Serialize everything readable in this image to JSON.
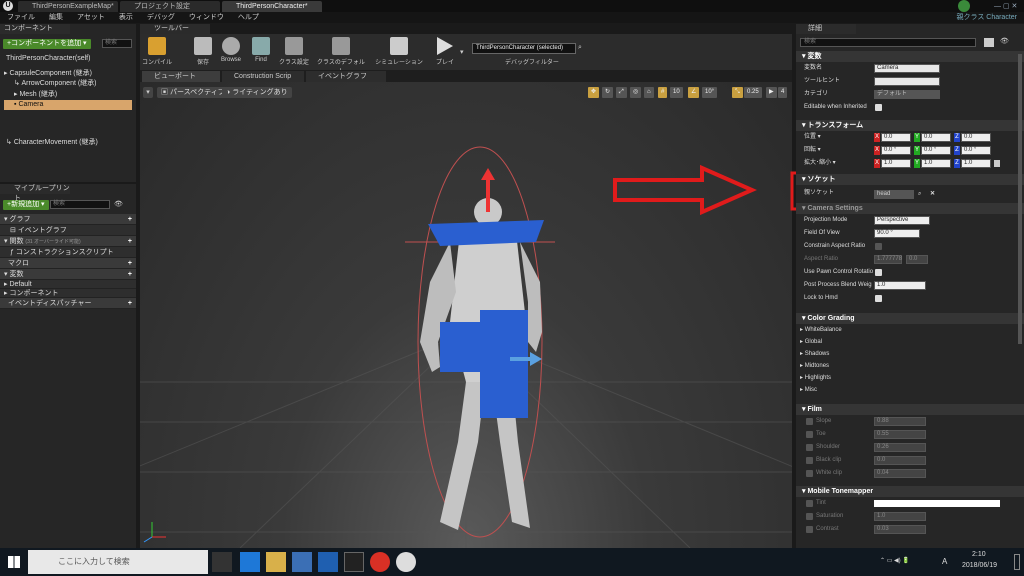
{
  "window": {
    "tabs": [
      "ThirdPersonExampleMap*",
      "プロジェクト設定",
      "ThirdPersonCharacter*"
    ],
    "parent_class_label": "親クラス Character"
  },
  "menu": [
    "ファイル",
    "編集",
    "アセット",
    "表示",
    "デバッグ",
    "ウィンドウ",
    "ヘルプ"
  ],
  "components": {
    "tab": "コンポーネント",
    "add_button": "+コンポーネントを追加 ▾",
    "search_placeholder": "検索",
    "root": "ThirdPersonCharacter(self)",
    "items": [
      "CapsuleComponent (継承)",
      "ArrowComponent (継承)",
      "Mesh (継承)",
      "Camera",
      "CharacterMovement (継承)"
    ]
  },
  "my_blueprint": {
    "tab": "マイブループリント",
    "add_button": "+新規追加 ▾",
    "search_placeholder": "検索",
    "graph_header": "グラフ",
    "event_graph": "イベントグラフ",
    "functions_header": "関数",
    "functions_note": "(31 オーバーライド可能)",
    "construction_script": "コンストラクションスクリプト",
    "macros_header": "マクロ",
    "variables_header": "変数",
    "default_label": "Default",
    "components_label": "コンポーネント",
    "dispatchers_header": "イベントディスパッチャー"
  },
  "toolbar": {
    "tab": "ツールバー",
    "buttons": [
      "コンパイル",
      "保存",
      "Browse",
      "Find",
      "クラス設定",
      "クラスのデフォルト",
      "シミュレーション",
      "プレイ"
    ],
    "debug_select": "ThirdPersonCharacter (selected)",
    "debug_filter_label": "デバッグフィルター"
  },
  "viewport": {
    "tabs": [
      "ビューポート",
      "Construction Scrip",
      "イベントグラフ"
    ],
    "perspective_button": "パースペクティブ",
    "lighting_button": "ライティングあり",
    "snap_grid": "10",
    "snap_rotation": "10°",
    "snap_scale": "0.25",
    "camera_speed": "4"
  },
  "details": {
    "tab": "詳細",
    "search_placeholder": "検索",
    "variable_section": "変数",
    "var_name_label": "変数名",
    "var_name_value": "Camera",
    "tooltip_label": "ツールヒント",
    "category_label": "カテゴリ",
    "category_value": "デフォルト",
    "editable_label": "Editable when Inherited",
    "transform_section": "トランスフォーム",
    "location_label": "位置 ▾",
    "location": [
      "0.0",
      "0.0",
      "0.0"
    ],
    "rotation_label": "回転 ▾",
    "rotation": [
      "0.0 °",
      "0.0 °",
      "0.0 °"
    ],
    "scale_label": "拡大･縮小 ▾",
    "scale": [
      "1.0",
      "1.0",
      "1.0"
    ],
    "socket_section": "ソケット",
    "parent_socket_label": "親ソケット",
    "parent_socket_value": "head",
    "camera_settings_section": "Camera Settings",
    "projection_mode_label": "Projection Mode",
    "projection_mode_value": "Perspective",
    "fov_label": "Field Of View",
    "fov_value": "90.0 °",
    "constrain_label": "Constrain Aspect Ratio",
    "aspect_label": "Aspect Ratio",
    "aspect_value_a": "1.777778",
    "aspect_value_b": "0.0",
    "pawn_rotation_label": "Use Pawn Control Rotatio",
    "pp_blend_label": "Post Process Blend Weig",
    "pp_blend_value": "1.0",
    "lock_hmd_label": "Lock to Hmd",
    "color_grading_section": "Color Grading",
    "color_grading_items": [
      "WhiteBalance",
      "Global",
      "Shadows",
      "Midtones",
      "Highlights",
      "Misc"
    ],
    "film_section": "Film",
    "film_items": [
      {
        "label": "Slope",
        "value": "0.88"
      },
      {
        "label": "Toe",
        "value": "0.55"
      },
      {
        "label": "Shoulder",
        "value": "0.26"
      },
      {
        "label": "Black clip",
        "value": "0.0"
      },
      {
        "label": "White clip",
        "value": "0.04"
      }
    ],
    "mobile_section": "Mobile Tonemapper",
    "mobile_items": [
      {
        "label": "Tint",
        "value": ""
      },
      {
        "label": "Saturation",
        "value": "1.0"
      },
      {
        "label": "Contrast",
        "value": "0.03"
      }
    ]
  },
  "taskbar": {
    "search_placeholder": "ここに入力して検索",
    "time": "2:10",
    "date": "2018/06/19",
    "ime": "A"
  },
  "colors": {
    "highlight_red": "#e01b1b",
    "selection": "#d8a56b",
    "add_green": "#4a8a2a"
  }
}
